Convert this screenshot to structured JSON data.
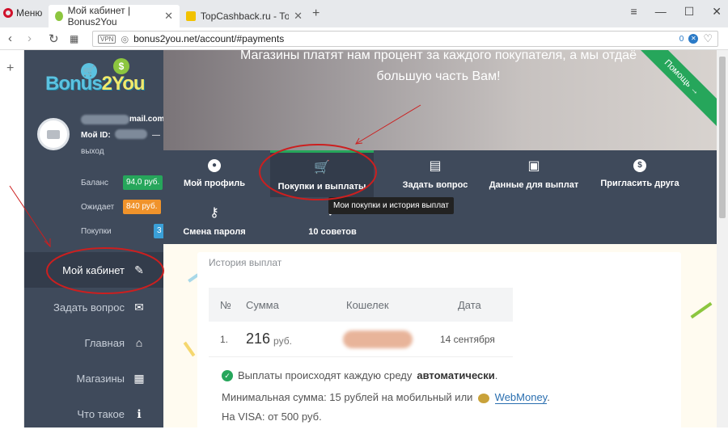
{
  "browser": {
    "menu_label": "Меню",
    "tabs": [
      {
        "title": "Мой кабинет | Bonus2You",
        "active": true
      },
      {
        "title": "TopCashback.ru - Топ луч",
        "active": false
      }
    ],
    "new_tab": "+",
    "url": "bonus2you.net/account/#payments",
    "vpn_label": "VPN",
    "adblock_count": "0"
  },
  "sidebar": {
    "logo": {
      "part1": "Bonus",
      "part2": "2You"
    },
    "user": {
      "email_suffix": "mail.com",
      "id_label": "Мой ID:",
      "id_dash": "—",
      "logout": "выход"
    },
    "stats": [
      {
        "label": "Баланс",
        "value": "94,0 руб.",
        "color": "#26a65b"
      },
      {
        "label": "Ожидает",
        "value": "840 руб.",
        "color": "#f0932b"
      },
      {
        "label": "Покупки",
        "value": "3",
        "color": "#3aa0d8"
      }
    ],
    "nav": [
      {
        "label": "Мой кабинет",
        "icon": "pencil-icon",
        "active": true
      },
      {
        "label": "Задать вопрос",
        "icon": "envelope-icon",
        "active": false
      },
      {
        "label": "Главная",
        "icon": "home-icon",
        "active": false
      },
      {
        "label": "Магазины",
        "icon": "grid-icon",
        "active": false
      },
      {
        "label": "Что такое",
        "icon": "info-icon",
        "active": false
      }
    ]
  },
  "banner": {
    "text_line1": "Магазины платят нам процент за каждого покупателя, а мы отдаё",
    "text_line2": "большую часть Вам!",
    "ribbon": "Помощь →"
  },
  "account_nav": {
    "items": [
      {
        "label": "Мой профиль",
        "icon": "user-icon"
      },
      {
        "label": "Покупки и выплаты",
        "icon": "cart-icon",
        "selected": true
      },
      {
        "label": "Задать вопрос",
        "icon": "chat-icon"
      },
      {
        "label": "Данные для выплат",
        "icon": "wallet-icon"
      },
      {
        "label": "Пригласить друга",
        "icon": "dollar-icon"
      },
      {
        "label": "Смена пароля",
        "icon": "key-icon"
      },
      {
        "label": "10 советов",
        "icon": "check-icon"
      }
    ],
    "tooltip": "Мои покупки и история выплат"
  },
  "payments": {
    "title": "История выплат",
    "columns": [
      "№",
      "Сумма",
      "Кошелек",
      "Дата"
    ],
    "rows": [
      {
        "num": "1.",
        "amount": "216",
        "currency": "руб.",
        "date": "14 сентября"
      }
    ],
    "notice_prefix": "Выплаты происходят каждую среду",
    "notice_bold": "автоматически",
    "notice_suffix": ".",
    "min_text": "Минимальная сумма: 15 рублей на мобильный или",
    "webmoney": "WebMoney",
    "min_suffix": ".",
    "visa_text": "На VISA: от 500 руб."
  },
  "colors": {
    "sidebar": "#3f4a5b",
    "accent_green": "#26a65b",
    "annotation_red": "#cc1f1f"
  }
}
